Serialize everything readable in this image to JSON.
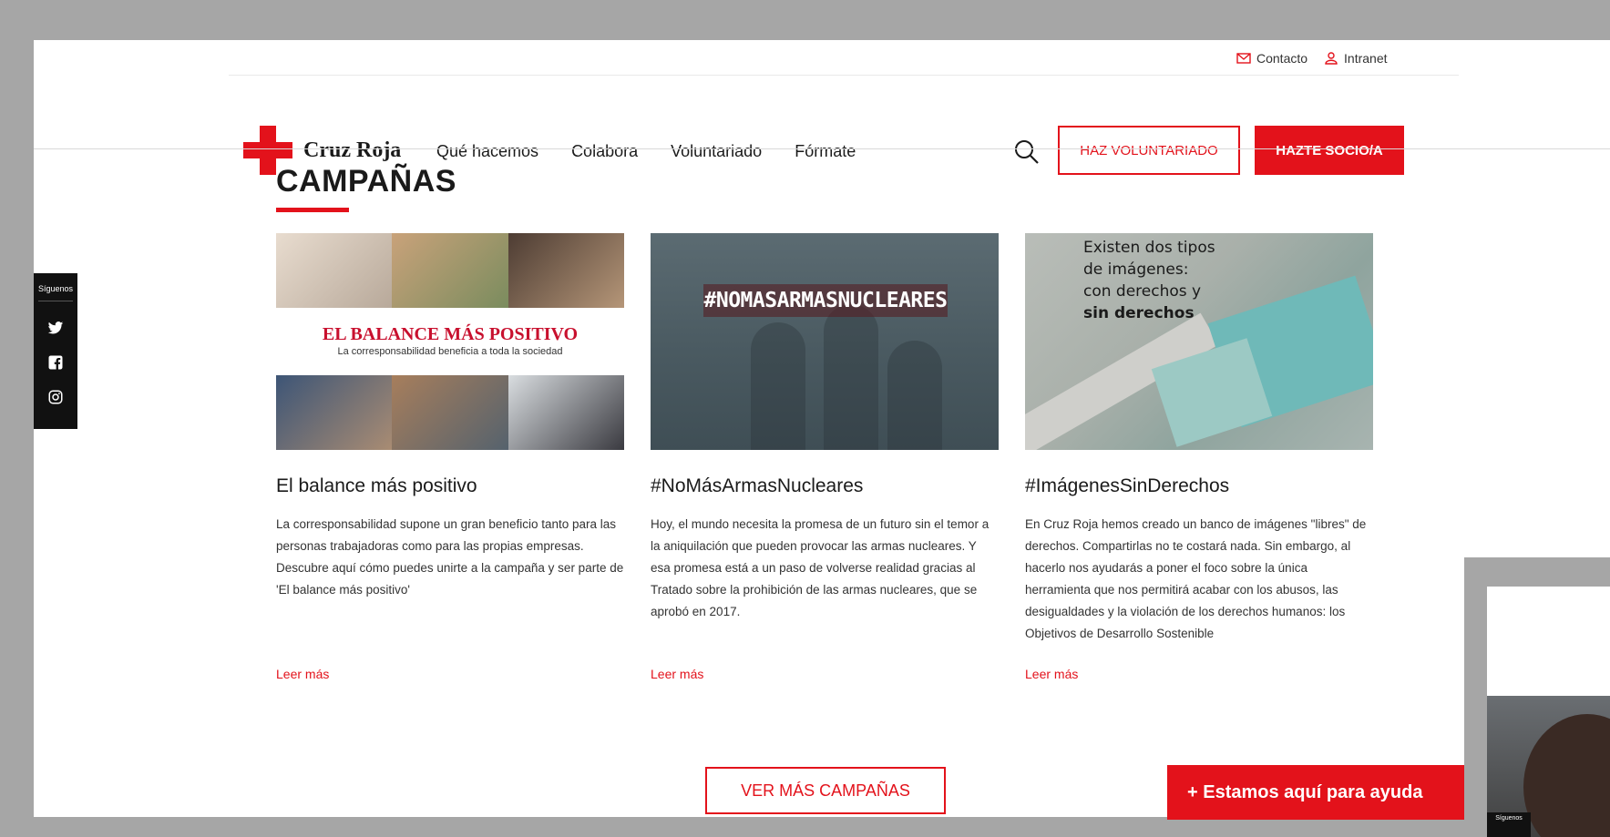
{
  "utility": {
    "contact": "Contacto",
    "intranet": "Intranet"
  },
  "logo": {
    "text": "Cruz Roja"
  },
  "nav": [
    "Qué hacemos",
    "Colabora",
    "Voluntariado",
    "Fórmate"
  ],
  "header_buttons": {
    "volunteer": "HAZ VOLUNTARIADO",
    "member": "HAZTE SOCIO/A"
  },
  "section": {
    "title": "CAMPAÑAS"
  },
  "cards": [
    {
      "title": "El balance más positivo",
      "image_title": "EL BALANCE MÁS POSITIVO",
      "image_subtitle": "La corresponsabilidad beneficia a toda la sociedad",
      "text": "La corresponsabilidad supone un gran beneficio tanto para las personas trabajadoras como para las propias empresas. Descubre aquí cómo puedes unirte a la campaña y ser parte de 'El balance más positivo'",
      "link": "Leer más"
    },
    {
      "title": "#NoMásArmasNucleares",
      "image_tag": "#NOMASARMASNUCLEARES",
      "text": "Hoy, el mundo necesita la promesa de un futuro sin el temor a la aniquilación que pueden provocar las armas nucleares. Y esa promesa está a un paso de volverse realidad gracias al Tratado sobre la prohibición de las armas nucleares, que se aprobó en 2017.",
      "link": "Leer más"
    },
    {
      "title": "#ImágenesSinDerechos",
      "image_lines": [
        "Existen dos tipos",
        "de imágenes:",
        "con derechos y"
      ],
      "image_bold": "sin derechos",
      "text": "En Cruz Roja hemos creado un banco de imágenes \"libres\" de derechos. Compartirlas no te costará nada. Sin embargo, al hacerlo nos ayudarás a poner el foco sobre la única herramienta que nos permitirá acabar con los abusos, las desigualdades y la violación de los derechos humanos: los Objetivos de Desarrollo Sostenible",
      "link": "Leer más"
    }
  ],
  "more_button": "VER MÁS CAMPAÑAS",
  "help_bar": "+ Estamos aquí para ayuda",
  "social": {
    "label": "Síguenos",
    "icons": [
      "twitter-icon",
      "facebook-icon",
      "instagram-icon"
    ]
  },
  "thumbnail": {
    "label": "Síguenos"
  },
  "colors": {
    "brand_red": "#e3121b",
    "background": "#a6a6a6",
    "text": "#1a1a1a"
  }
}
